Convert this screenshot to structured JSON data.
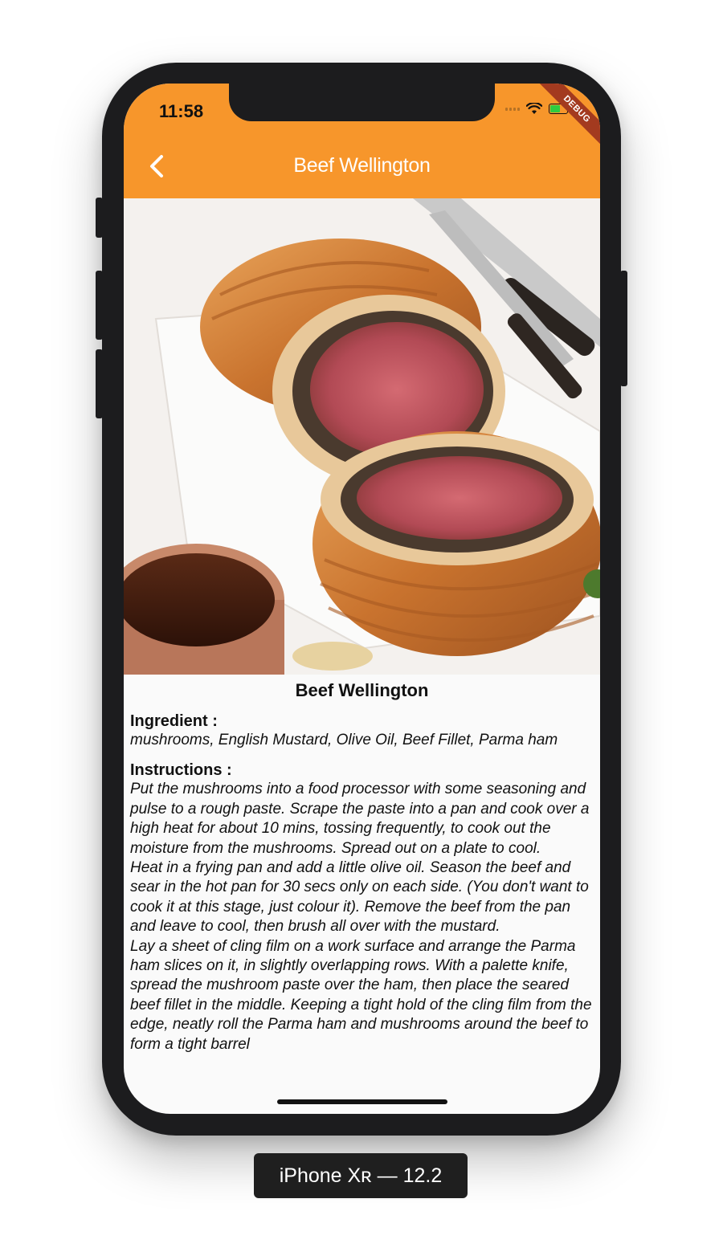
{
  "status_bar": {
    "time": "11:58",
    "debug_label": "DEBUG"
  },
  "app_bar": {
    "title": "Beef Wellington",
    "back_icon": "chevron-left-icon"
  },
  "recipe": {
    "name": "Beef Wellington",
    "ingredient_heading": "Ingredient :",
    "ingredients": "mushrooms, English Mustard, Olive Oil, Beef Fillet, Parma ham",
    "instructions_heading": "Instructions :",
    "instructions": "Put the mushrooms into a food processor with some seasoning and pulse to a rough paste. Scrape the paste into a pan and cook over a high heat for about 10 mins, tossing frequently, to cook out the moisture from the mushrooms. Spread out on a plate to cool.\nHeat in a frying pan and add a little olive oil. Season the beef and sear in the hot pan for 30 secs only on each side. (You don't want to cook it at this stage, just colour it). Remove the beef from the pan and leave to cool, then brush all over with the mustard.\nLay a sheet of cling film on a work surface and arrange the Parma ham slices on it, in slightly overlapping rows. With a palette knife, spread the mushroom paste over the ham, then place the seared beef fillet in the middle. Keeping a tight hold of the cling film from the edge, neatly roll the Parma ham and mushrooms around the beef to form a tight barrel"
  },
  "device_label": "iPhone Xʀ — 12.2",
  "colors": {
    "app_bar": "#f7962b",
    "debug_ribbon": "#a33a1f"
  }
}
